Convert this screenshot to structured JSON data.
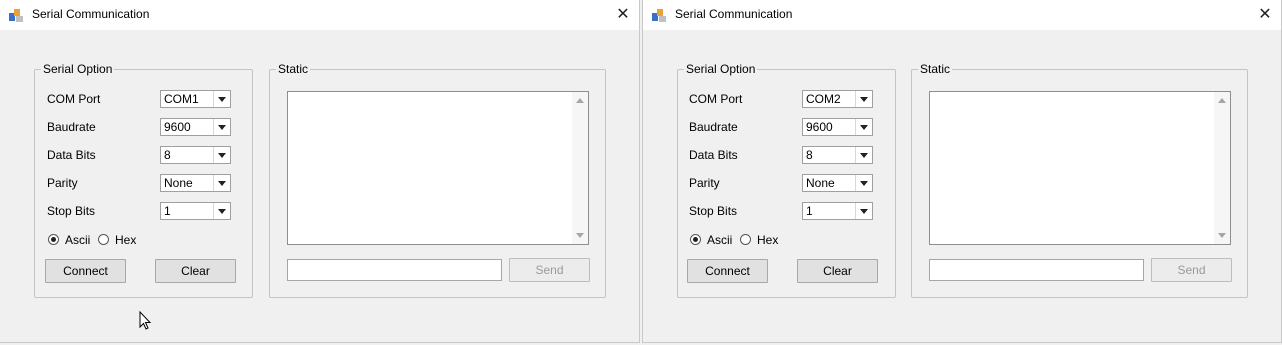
{
  "windows": [
    {
      "title": "Serial Communication",
      "close_glyph": "✕",
      "serial_option": {
        "legend": "Serial Option",
        "com_port": {
          "label": "COM Port",
          "value": "COM1"
        },
        "baudrate": {
          "label": "Baudrate",
          "value": "9600"
        },
        "data_bits": {
          "label": "Data Bits",
          "value": "8"
        },
        "parity": {
          "label": "Parity",
          "value": "None"
        },
        "stop_bits": {
          "label": "Stop Bits",
          "value": "1"
        },
        "ascii_label": "Ascii",
        "hex_label": "Hex",
        "selected_mode": "Ascii",
        "connect_label": "Connect",
        "clear_label": "Clear"
      },
      "static_group": {
        "legend": "Static",
        "send_label": "Send",
        "send_input_value": ""
      }
    },
    {
      "title": "Serial Communication",
      "close_glyph": "✕",
      "serial_option": {
        "legend": "Serial Option",
        "com_port": {
          "label": "COM Port",
          "value": "COM2"
        },
        "baudrate": {
          "label": "Baudrate",
          "value": "9600"
        },
        "data_bits": {
          "label": "Data Bits",
          "value": "8"
        },
        "parity": {
          "label": "Parity",
          "value": "None"
        },
        "stop_bits": {
          "label": "Stop Bits",
          "value": "1"
        },
        "ascii_label": "Ascii",
        "hex_label": "Hex",
        "selected_mode": "Ascii",
        "connect_label": "Connect",
        "clear_label": "Clear"
      },
      "static_group": {
        "legend": "Static",
        "send_label": "Send",
        "send_input_value": ""
      }
    }
  ],
  "icons": {
    "app": "serial-app-icon",
    "close": "close-icon",
    "cursor": "mouse-cursor-icon"
  }
}
